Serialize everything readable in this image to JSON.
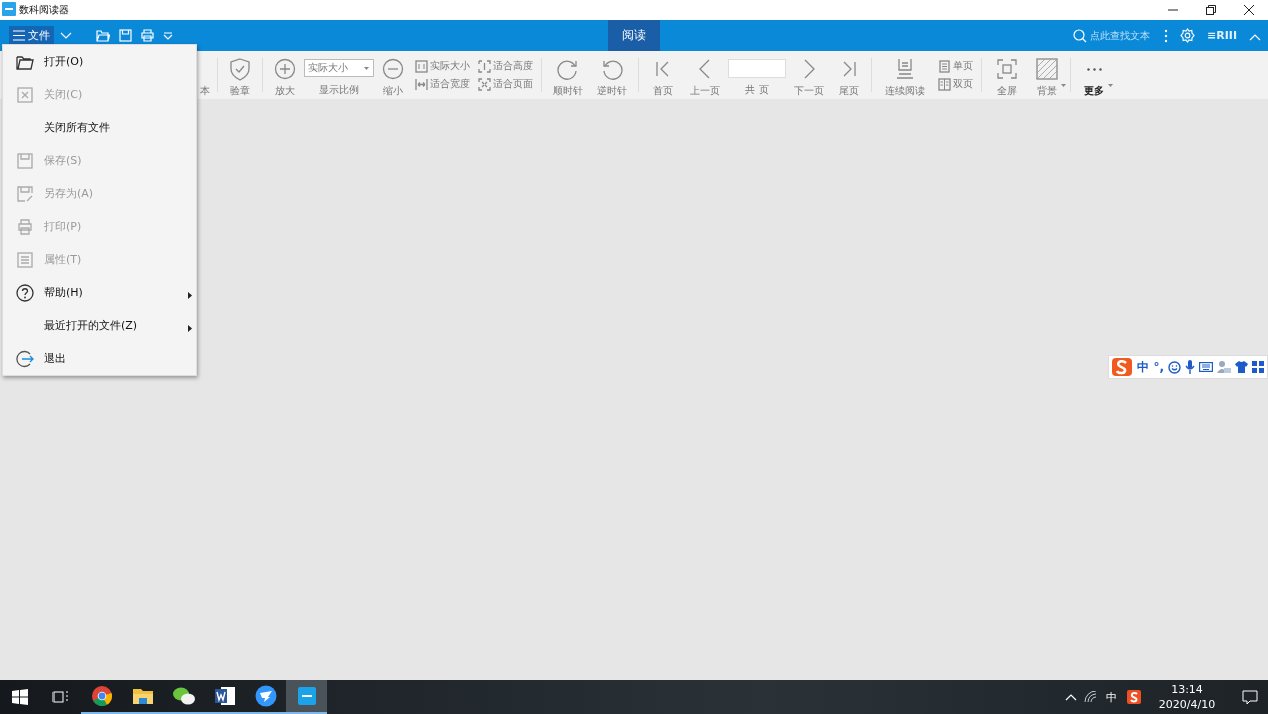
{
  "window": {
    "title": "数科阅读器"
  },
  "file_button": {
    "label": "文件",
    "selected": true
  },
  "tabs": [
    {
      "label": "阅读",
      "selected": true
    }
  ],
  "search": {
    "placeholder": "点此查找文本"
  },
  "user_label": "≡RIII",
  "toolbar": [
    {
      "kind": "cut",
      "label": "本"
    },
    {
      "kind": "sep"
    },
    {
      "kind": "stamp",
      "label": "验章"
    },
    {
      "kind": "sep"
    },
    {
      "kind": "zoomin",
      "label": "放大"
    },
    {
      "kind": "combo",
      "value": "实际大小",
      "label": "显示比例"
    },
    {
      "kind": "zoomout",
      "label": "缩小"
    },
    {
      "kind": "pair",
      "items": [
        "实际大小",
        "适合宽度"
      ]
    },
    {
      "kind": "pair",
      "items": [
        "适合高度",
        "适合页面"
      ]
    },
    {
      "kind": "sep"
    },
    {
      "kind": "rotatecw",
      "label": "顺时针"
    },
    {
      "kind": "rotateccw",
      "label": "逆时针"
    },
    {
      "kind": "sep"
    },
    {
      "kind": "first",
      "label": "首页"
    },
    {
      "kind": "prev",
      "label": "上一页"
    },
    {
      "kind": "pager",
      "label": "共 页"
    },
    {
      "kind": "next",
      "label": "下一页"
    },
    {
      "kind": "last",
      "label": "尾页"
    },
    {
      "kind": "sep"
    },
    {
      "kind": "continuous",
      "label": "连续阅读"
    },
    {
      "kind": "pair",
      "items": [
        "单页",
        "双页"
      ]
    },
    {
      "kind": "sep"
    },
    {
      "kind": "fullscreen",
      "label": "全屏"
    },
    {
      "kind": "background",
      "label": "背景",
      "dropdown": true
    },
    {
      "kind": "sep"
    },
    {
      "kind": "more",
      "label": "更多",
      "dropdown": true
    }
  ],
  "file_menu": [
    {
      "kind": "open",
      "label": "打开(O)",
      "disabled": false,
      "submenu": false
    },
    {
      "kind": "close",
      "label": "关闭(C)",
      "disabled": true,
      "submenu": false
    },
    {
      "kind": "none",
      "label": "关闭所有文件",
      "disabled": false,
      "submenu": false
    },
    {
      "kind": "save",
      "label": "保存(S)",
      "disabled": true,
      "submenu": false
    },
    {
      "kind": "saveas",
      "label": "另存为(A)",
      "disabled": true,
      "submenu": false
    },
    {
      "kind": "print",
      "label": "打印(P)",
      "disabled": true,
      "submenu": false
    },
    {
      "kind": "props",
      "label": "属性(T)",
      "disabled": true,
      "submenu": false
    },
    {
      "kind": "help",
      "label": "帮助(H)",
      "disabled": false,
      "submenu": true
    },
    {
      "kind": "none",
      "label": "最近打开的文件(Z)",
      "disabled": false,
      "submenu": true
    },
    {
      "kind": "exit",
      "label": "退出",
      "disabled": false,
      "submenu": false
    }
  ],
  "ime_toolbar": {
    "mode": "中",
    "punctuation": "°,"
  },
  "taskbar": {
    "apps": [
      {
        "kind": "chrome",
        "selected": false
      },
      {
        "kind": "folder",
        "selected": false
      },
      {
        "kind": "chat",
        "selected": false
      },
      {
        "kind": "word",
        "selected": false
      },
      {
        "kind": "bird",
        "selected": false
      },
      {
        "kind": "ofd",
        "selected": true
      }
    ],
    "ime": "中",
    "time": "13:14",
    "date": "2020/4/10"
  }
}
